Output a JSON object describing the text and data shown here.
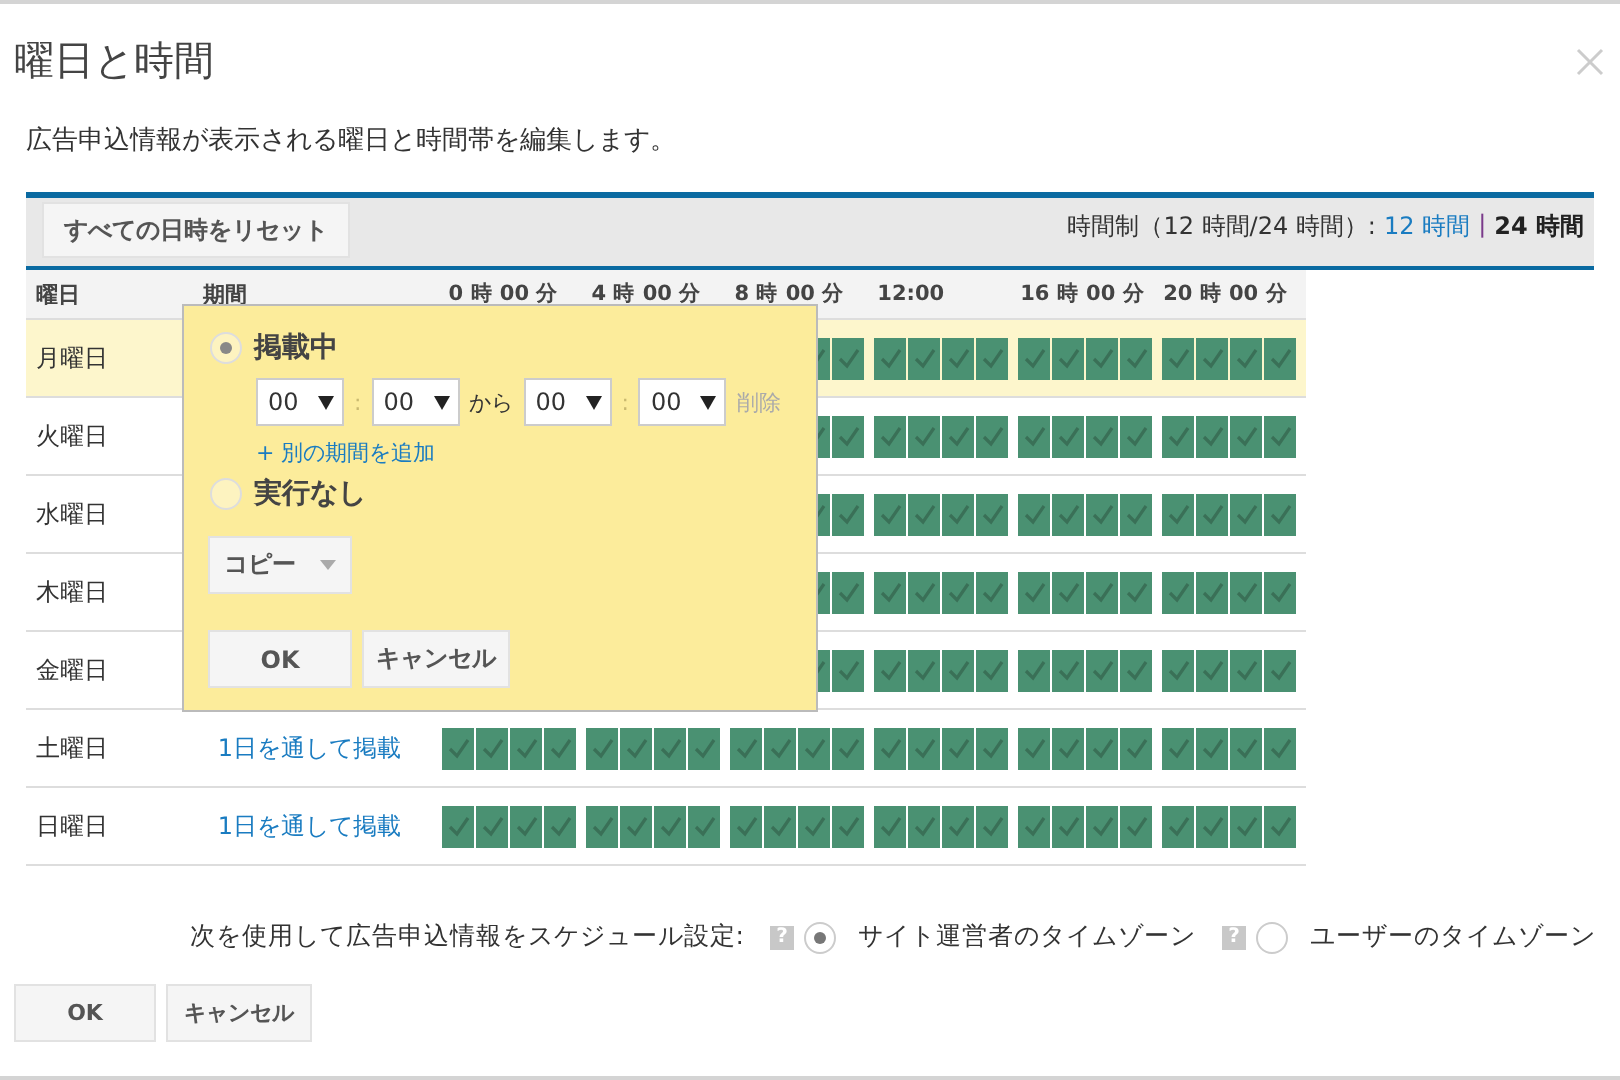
{
  "dialog": {
    "title": "曜日と時間",
    "description": "広告申込情報が表示される曜日と時間帯を編集します。"
  },
  "toolbar": {
    "reset_button": "すべての日時をリセット",
    "format_label": "時間制（12 時間/24 時間）:",
    "formats": [
      {
        "label": "12 時間",
        "selected": false
      },
      {
        "label": "24 時間",
        "selected": true
      }
    ],
    "separator": "|"
  },
  "table": {
    "columns": [
      "曜日",
      "期間"
    ],
    "hours": [
      "0 時 00 分",
      "4 時 00 分",
      "8 時 00 分",
      "12:00",
      "16 時 00 分",
      "20 時 00 分"
    ],
    "rows": [
      {
        "day": "月曜日",
        "selected": true,
        "slots": [
          true,
          true,
          true,
          true,
          true,
          true,
          true,
          true,
          true,
          true,
          true,
          true,
          true,
          true
        ]
      },
      {
        "day": "火曜日",
        "selected": false,
        "slots": [
          true,
          true,
          true,
          true,
          true,
          true,
          true,
          true,
          true,
          true,
          true,
          true,
          true,
          true
        ]
      },
      {
        "day": "水曜日",
        "selected": false,
        "slots": [
          true,
          true,
          true,
          true,
          true,
          true,
          true,
          true,
          true,
          true,
          true,
          true,
          true,
          true
        ]
      },
      {
        "day": "木曜日",
        "selected": false,
        "slots": [
          true,
          true,
          true,
          true,
          true,
          true,
          true,
          true,
          true,
          true,
          true,
          true,
          true,
          true
        ]
      },
      {
        "day": "金曜日",
        "selected": false,
        "slots": [
          true,
          true,
          true,
          true,
          true,
          true,
          true,
          true,
          true,
          true,
          true,
          true,
          true,
          true
        ]
      },
      {
        "day": "土曜日",
        "selected": false,
        "period": "1日を通して掲載",
        "slots": [
          true,
          true,
          true,
          true,
          true,
          true,
          true,
          true,
          true,
          true,
          true,
          true,
          true,
          true,
          true,
          true,
          true,
          true,
          true,
          true,
          true,
          true,
          true,
          true
        ]
      },
      {
        "day": "日曜日",
        "selected": false,
        "period": "1日を通して掲載",
        "slots": [
          true,
          true,
          true,
          true,
          true,
          true,
          true,
          true,
          true,
          true,
          true,
          true,
          true,
          true,
          true,
          true,
          true,
          true,
          true,
          true,
          true,
          true,
          true,
          true
        ]
      }
    ]
  },
  "popup": {
    "options": [
      {
        "label": "掲載中",
        "selected": true
      },
      {
        "label": "実行なし",
        "selected": false
      }
    ],
    "period": {
      "start_hour": "00",
      "start_separator": ":",
      "start_minute": "00",
      "connector": "から",
      "end_hour": "00",
      "end_separator": ":",
      "end_minute": "00",
      "delete": "削除"
    },
    "add_period": "+ 別の期間を追加",
    "copy_button": "コピー",
    "ok_button": "OK",
    "cancel_button": "キャンセル"
  },
  "footer": {
    "label": "次を使用して広告申込情報をスケジュール設定:",
    "timezones": [
      {
        "help": "?",
        "label": "サイト運営者のタイムゾーン",
        "selected": true
      },
      {
        "help": "?",
        "label": "ユーザーのタイムゾーン",
        "selected": false
      }
    ]
  },
  "buttons": {
    "ok": "OK",
    "cancel": "キャンセル"
  }
}
